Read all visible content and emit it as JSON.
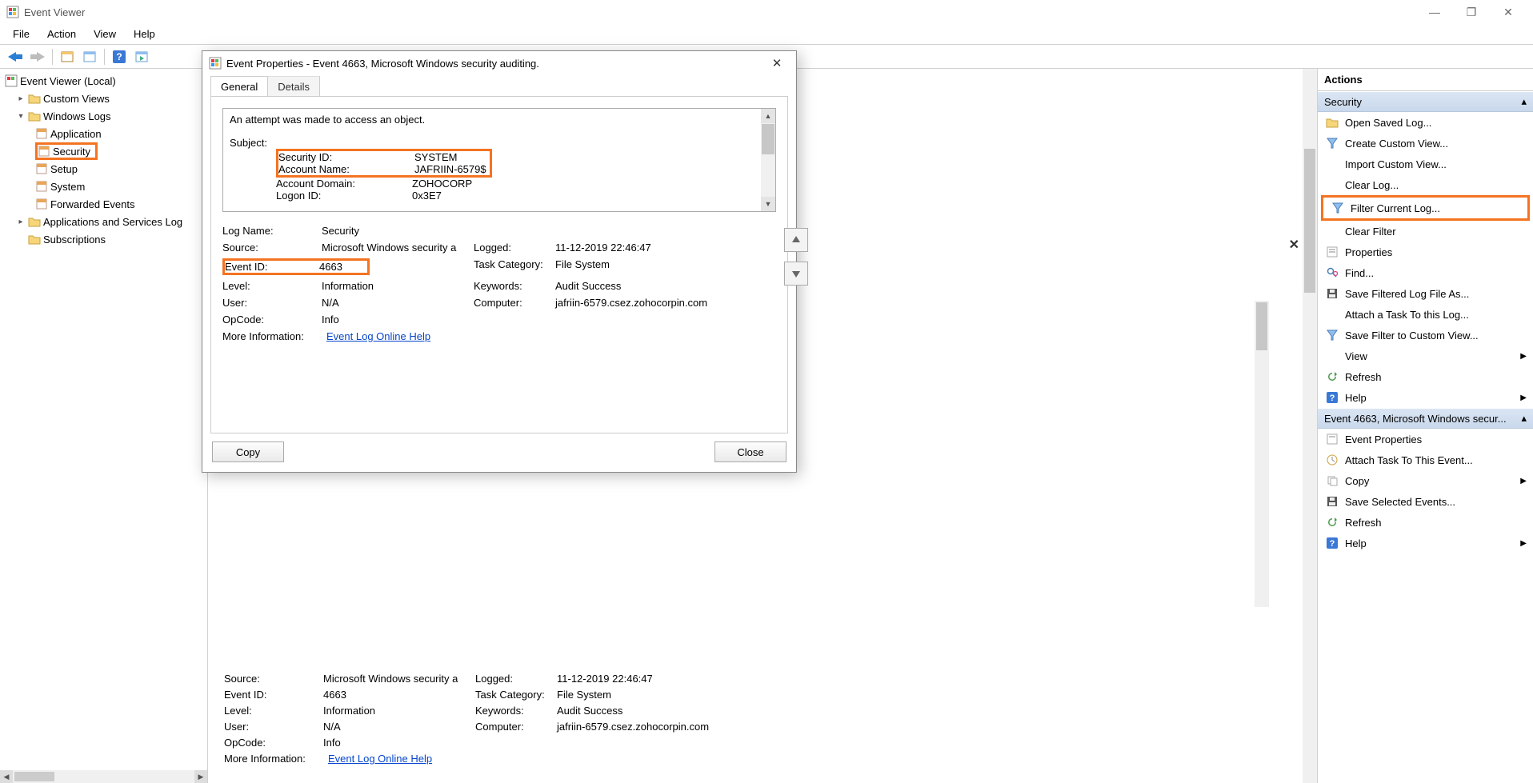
{
  "window": {
    "title": "Event Viewer",
    "min": "—",
    "max": "❐",
    "close": "✕"
  },
  "menu": {
    "file": "File",
    "action": "Action",
    "view": "View",
    "help": "Help"
  },
  "tree": {
    "root": "Event Viewer (Local)",
    "custom": "Custom Views",
    "winlogs": "Windows Logs",
    "application": "Application",
    "security": "Security",
    "setup": "Setup",
    "system": "System",
    "forwarded": "Forwarded Events",
    "appsvc": "Applications and Services Log",
    "subs": "Subscriptions"
  },
  "dialog": {
    "title": "Event Properties - Event 4663, Microsoft Windows security auditing.",
    "tab_general": "General",
    "tab_details": "Details",
    "desc_line1": "An attempt was made to access an object.",
    "subject_header": "Subject:",
    "sec_id_label": "Security ID:",
    "sec_id_val": "SYSTEM",
    "acct_name_label": "Account Name:",
    "acct_name_val": "JAFRIIN-6579$",
    "acct_domain_label": "Account Domain:",
    "acct_domain_val": "ZOHOCORP",
    "logon_id_label": "Logon ID:",
    "logon_id_val": "0x3E7",
    "logname_label": "Log Name:",
    "logname_val": "Security",
    "source_label": "Source:",
    "source_val": "Microsoft Windows security a",
    "logged_label": "Logged:",
    "logged_val": "11-12-2019 22:46:47",
    "eventid_label": "Event ID:",
    "eventid_val": "4663",
    "taskcat_label": "Task Category:",
    "taskcat_val": "File System",
    "level_label": "Level:",
    "level_val": "Information",
    "keywords_label": "Keywords:",
    "keywords_val": "Audit Success",
    "user_label": "User:",
    "user_val": "N/A",
    "computer_label": "Computer:",
    "computer_val": "jafriin-6579.csez.zohocorpin.com",
    "opcode_label": "OpCode:",
    "opcode_val": "Info",
    "moreinfo_label": "More Information:",
    "moreinfo_link": "Event Log Online Help",
    "copy": "Copy",
    "close": "Close"
  },
  "actions": {
    "header": "Actions",
    "section1": "Security",
    "open_saved": "Open Saved Log...",
    "create_view": "Create Custom View...",
    "import_view": "Import Custom View...",
    "clear_log": "Clear Log...",
    "filter_log": "Filter Current Log...",
    "clear_filter": "Clear Filter",
    "properties": "Properties",
    "find": "Find...",
    "save_filtered": "Save Filtered Log File As...",
    "attach_task_log": "Attach a Task To this Log...",
    "save_filter_view": "Save Filter to Custom View...",
    "view": "View",
    "refresh": "Refresh",
    "help": "Help",
    "section2": "Event 4663, Microsoft Windows secur...",
    "event_props": "Event Properties",
    "attach_task_event": "Attach Task To This Event...",
    "copy": "Copy",
    "save_selected": "Save Selected Events...",
    "refresh2": "Refresh",
    "help2": "Help"
  }
}
